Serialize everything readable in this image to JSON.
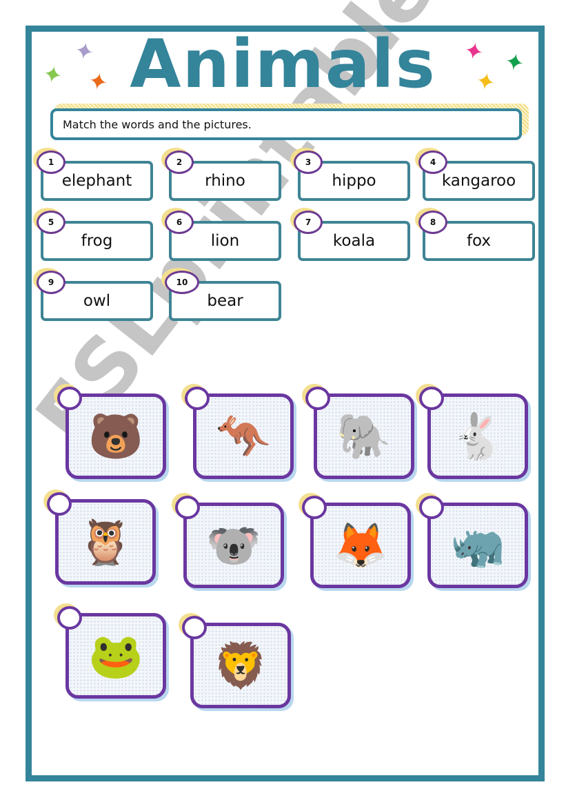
{
  "worksheet": {
    "title": "Animals",
    "instruction": "Match the words and the pictures.",
    "watermark": "ESLprintables.com",
    "colors": {
      "frame": "#34849a",
      "word_box_border": "#3f8494",
      "circle_border": "#6d3a91",
      "picture_border": "#6a37a0",
      "circle_glow": "#f3df8f"
    },
    "stars": [
      {
        "name": "lavender",
        "color": "#a99ccc",
        "glyph": "✦"
      },
      {
        "name": "green",
        "color": "#86c84e",
        "glyph": "✦"
      },
      {
        "name": "orange",
        "color": "#e86a1a",
        "glyph": "✦"
      },
      {
        "name": "pink",
        "color": "#e8348c",
        "glyph": "✦"
      },
      {
        "name": "dark-green",
        "color": "#12a04c",
        "glyph": "✦"
      },
      {
        "name": "yellow",
        "color": "#f4bd18",
        "glyph": "✦"
      }
    ],
    "words": [
      {
        "number": "1",
        "word": "elephant"
      },
      {
        "number": "2",
        "word": "rhino"
      },
      {
        "number": "3",
        "word": "hippo"
      },
      {
        "number": "4",
        "word": "kangaroo"
      },
      {
        "number": "5",
        "word": "frog"
      },
      {
        "number": "6",
        "word": "lion"
      },
      {
        "number": "7",
        "word": "koala"
      },
      {
        "number": "8",
        "word": "fox"
      },
      {
        "number": "9",
        "word": "owl"
      },
      {
        "number": "10",
        "word": "bear"
      }
    ],
    "pictures": [
      {
        "animal": "bear",
        "glyph": "🐻",
        "answer": ""
      },
      {
        "animal": "kangaroo",
        "glyph": "🦘",
        "answer": ""
      },
      {
        "animal": "elephant",
        "glyph": "🐘",
        "answer": ""
      },
      {
        "animal": "rabbit",
        "glyph": "🐇",
        "answer": ""
      },
      {
        "animal": "owl",
        "glyph": "🦉",
        "answer": ""
      },
      {
        "animal": "koala",
        "glyph": "🐨",
        "answer": ""
      },
      {
        "animal": "fox",
        "glyph": "🦊",
        "answer": ""
      },
      {
        "animal": "rhino",
        "glyph": "🦏",
        "answer": ""
      },
      {
        "animal": "frog",
        "glyph": "🐸",
        "answer": ""
      },
      {
        "animal": "lion",
        "glyph": "🦁",
        "answer": ""
      }
    ]
  }
}
